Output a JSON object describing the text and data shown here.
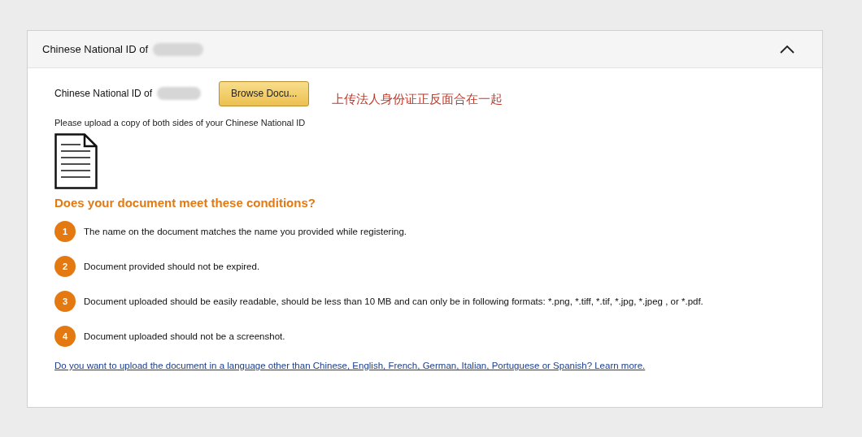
{
  "panel": {
    "title": "Chinese National ID of",
    "expanded": true
  },
  "upload": {
    "label": "Chinese National ID of",
    "button": "Browse Docu...",
    "note": "上传法人身份证正反面合在一起"
  },
  "instruction": "Please upload a copy of both sides of your Chinese National ID",
  "conditions": {
    "heading": "Does your document meet these conditions?",
    "items": [
      {
        "number": "1",
        "text": "The name on the document matches the name you provided while registering."
      },
      {
        "number": "2",
        "text": "Document provided should not be expired."
      },
      {
        "number": "3",
        "text": "Document uploaded should be easily readable, should be less than 10 MB and can only be in following formats: *.png, *.tiff, *.tif, *.jpg, *.jpeg , or *.pdf."
      },
      {
        "number": "4",
        "text": "Document uploaded should not be a screenshot."
      }
    ]
  },
  "language_link": "Do you want to upload the document in a language other than Chinese, English, French, German, Italian, Portuguese or Spanish? Learn more."
}
